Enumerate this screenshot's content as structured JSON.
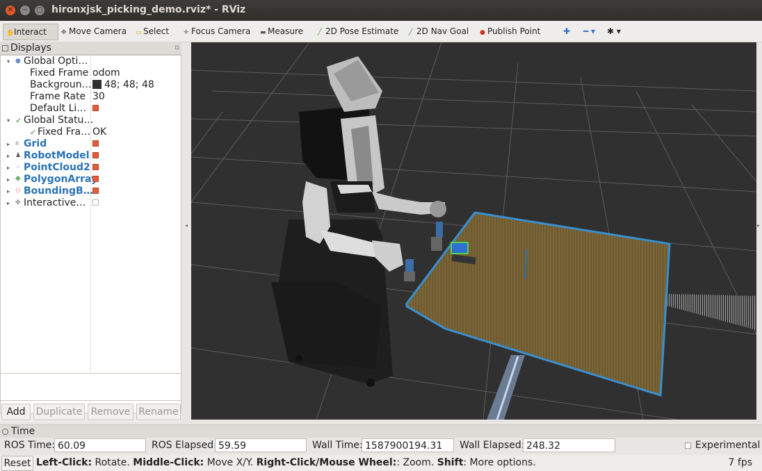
{
  "window": {
    "title": "hironxjsk_picking_demo.rviz* - RViz"
  },
  "toolbar": {
    "interact": "Interact",
    "move_camera": "Move Camera",
    "select": "Select",
    "focus_camera": "Focus Camera",
    "measure": "Measure",
    "pose_estimate": "2D Pose Estimate",
    "nav_goal": "2D Nav Goal",
    "publish_point": "Publish Point"
  },
  "displays": {
    "title": "Displays",
    "global_options": {
      "label": "Global Opti…",
      "fixed_frame_label": "Fixed Frame",
      "fixed_frame_value": "odom",
      "background_label": "Backgroun…",
      "background_value": "48; 48; 48",
      "frame_rate_label": "Frame Rate",
      "frame_rate_value": "30",
      "default_light_label": "Default Li…"
    },
    "global_status": {
      "label": "Global Statu…",
      "fixed_frame_label": "Fixed Fra…",
      "fixed_frame_value": "OK"
    },
    "items": [
      {
        "label": "Grid",
        "checked": true
      },
      {
        "label": "RobotModel",
        "checked": true
      },
      {
        "label": "PointCloud2",
        "checked": true
      },
      {
        "label": "PolygonArray",
        "checked": true
      },
      {
        "label": "BoundingB…",
        "checked": true
      },
      {
        "label": "Interactive…",
        "checked": false
      }
    ],
    "buttons": {
      "add": "Add",
      "duplicate": "Duplicate",
      "remove": "Remove",
      "rename": "Rename"
    }
  },
  "time": {
    "title": "Time",
    "ros_time_label": "ROS Time:",
    "ros_time": "60.09",
    "ros_elapsed_label": "ROS Elapsed:",
    "ros_elapsed": "59.59",
    "wall_time_label": "Wall Time:",
    "wall_time": "1587900194.31",
    "wall_elapsed_label": "Wall Elapsed:",
    "wall_elapsed": "248.32",
    "experimental": "Experimental"
  },
  "status": {
    "reset": "Reset",
    "left_click": "Left-Click:",
    "left_click_desc": " Rotate. ",
    "middle_click": "Middle-Click:",
    "middle_click_desc": " Move X/Y. ",
    "right_click": "Right-Click/Mouse Wheel:",
    "right_click_desc": ": Zoom. ",
    "shift": "Shift",
    "shift_desc": ": More options.",
    "fps": "7 fps"
  },
  "colors": {
    "viewport_bg": "#303030",
    "accent_blue": "#2a72b5",
    "checkbox_on": "#e05d3a",
    "table": "#6e5a30",
    "table_edge": "#3a8fd1"
  }
}
